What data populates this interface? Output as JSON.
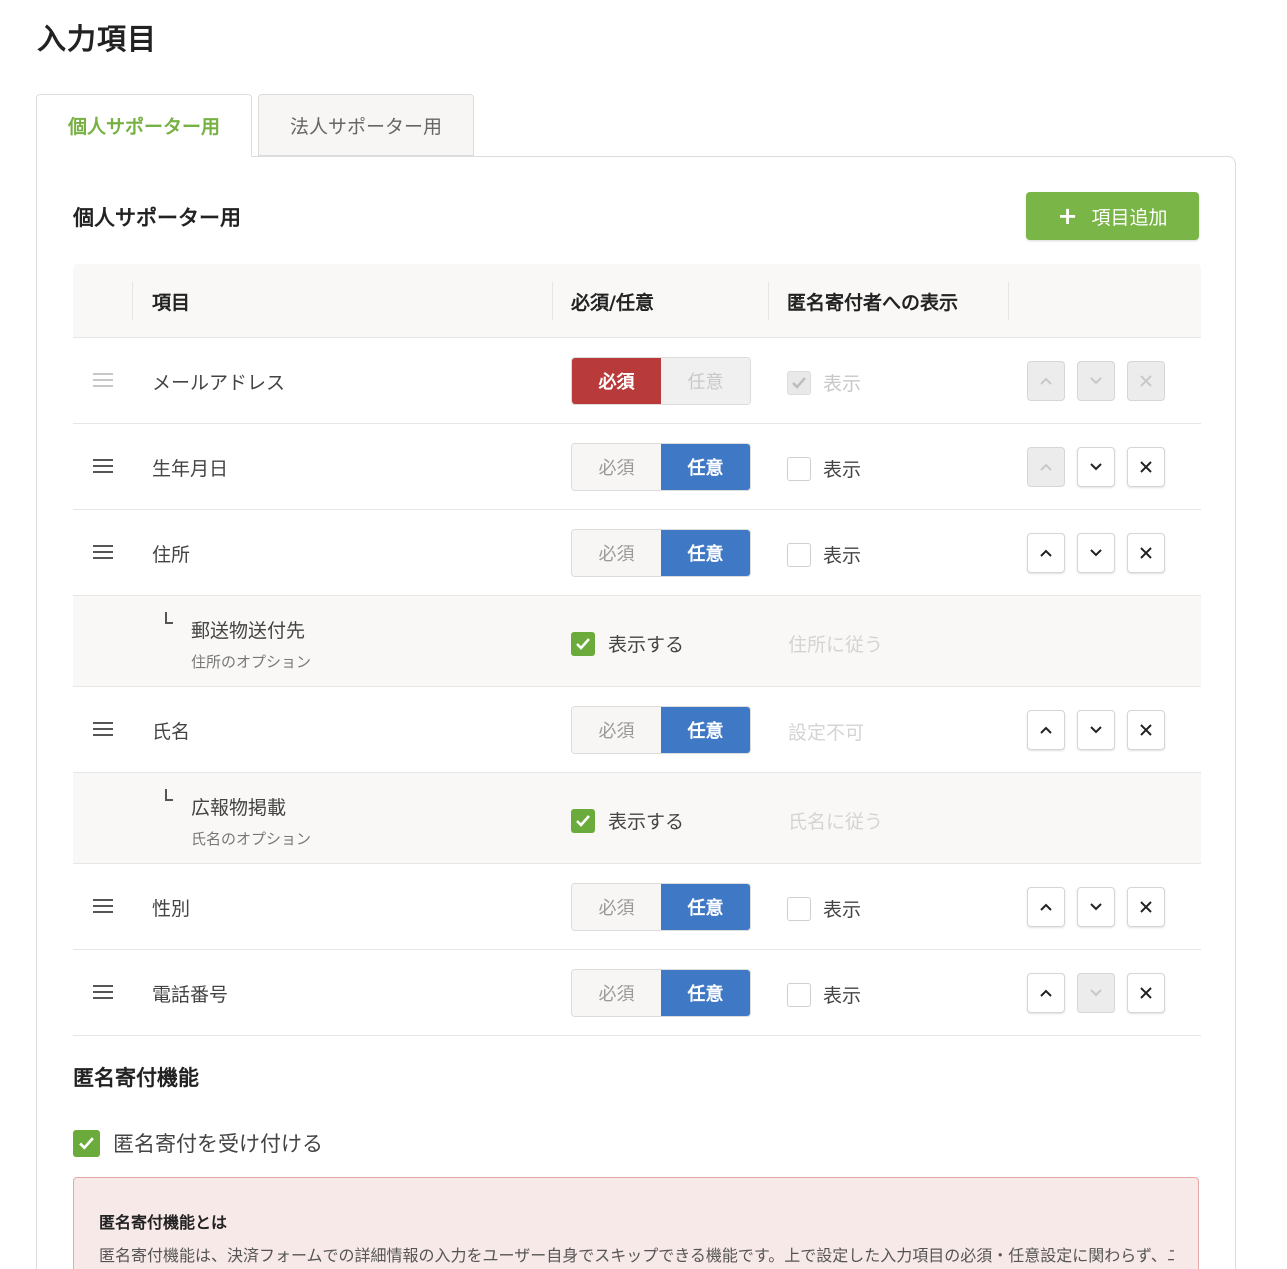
{
  "page": {
    "title": "入力項目"
  },
  "tabs": [
    {
      "label": "個人サポーター用",
      "active": true
    },
    {
      "label": "法人サポーター用",
      "active": false
    }
  ],
  "section": {
    "title": "個人サポーター用",
    "add_button_label": "項目追加"
  },
  "table": {
    "headers": {
      "item": "項目",
      "required": "必須/任意",
      "anonymous": "匿名寄付者への表示"
    },
    "segment_labels": {
      "required": "必須",
      "optional": "任意"
    },
    "show_label": "表示",
    "rows": [
      {
        "label": "メールアドレス",
        "mode": "必須",
        "show_checked": true,
        "show_disabled": true
      },
      {
        "label": "生年月日",
        "mode": "任意",
        "show_checked": false
      },
      {
        "label": "住所",
        "mode": "任意",
        "show_checked": false
      },
      {
        "label": "氏名",
        "mode": "任意",
        "note": "設定不可"
      },
      {
        "label": "性別",
        "mode": "任意",
        "show_checked": false
      },
      {
        "label": "電話番号",
        "mode": "任意",
        "show_checked": false
      }
    ],
    "sub_rows": [
      {
        "label": "郵送物送付先",
        "note": "住所のオプション",
        "check_label": "表示する",
        "checked": true,
        "follow": "住所に従う"
      },
      {
        "label": "広報物掲載",
        "note": "氏名のオプション",
        "check_label": "表示する",
        "checked": true,
        "follow": "氏名に従う"
      }
    ]
  },
  "anonymous": {
    "title": "匿名寄付機能",
    "accept_label": "匿名寄付を受け付ける",
    "accept_checked": true,
    "info_title": "匿名寄付機能とは",
    "info_body": "匿名寄付機能は、決済フォームでの詳細情報の入力をユーザー自身でスキップできる機能です。上で設定した入力項目の必須・任意設定に関わらず、ユー"
  },
  "colors": {
    "accent_green": "#7ab547",
    "required_red": "#b83a3a",
    "optional_blue": "#3f78c4"
  }
}
